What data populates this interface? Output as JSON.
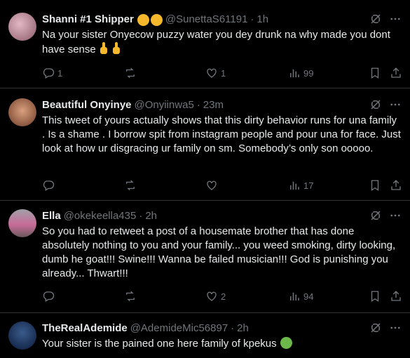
{
  "tweets": [
    {
      "name": "Shanni #1 Shipper",
      "handle": "@SunettaS61191",
      "time": "1h",
      "text": "Na your sister Onyecow puzzy water you dey drunk na why made you dont have sense",
      "replies": "1",
      "retweets": "",
      "likes": "1",
      "views": "99",
      "avatar_color": "#c48a9a"
    },
    {
      "name": "Beautiful Onyinye",
      "handle": "@Onyiinwa5",
      "time": "23m",
      "text": "This tweet of yours actually shows that this dirty behavior runs for una family . Is a shame . I borrow spit from instagram people and pour una for face. Just look at how ur disgracing ur family on sm. Somebody’s only son ooooo.",
      "replies": "",
      "retweets": "",
      "likes": "",
      "views": "17",
      "avatar_color": "#b87a5e"
    },
    {
      "name": "Ella",
      "handle": "@okekeella435",
      "time": "2h",
      "text": "So you had to retweet a post of a housemate brother that has done absolutely nothing to you and your family... you weed smoking, dirty looking, dumb he goat!!! Swine!!! Wanna be failed musician!!! God is punishing you already... Thwart!!!",
      "replies": "",
      "retweets": "",
      "likes": "2",
      "views": "94",
      "avatar_color": "#8a6a7a"
    },
    {
      "name": "TheRealAdemide",
      "handle": "@AdemideMic56897",
      "time": "2h",
      "text": "Your sister is the pained one here family of kpekus",
      "avatar_color": "#2a4a7a"
    }
  ],
  "separator": "·",
  "icons": {
    "grok": "grok-icon",
    "more": "more-icon",
    "reply": "reply-icon",
    "retweet": "retweet-icon",
    "like": "like-icon",
    "views": "views-icon",
    "bookmark": "bookmark-icon",
    "share": "share-icon"
  },
  "colors": {
    "text": "#e7e9ea",
    "muted": "#71767b",
    "border": "#2f3336",
    "background": "#000000"
  }
}
